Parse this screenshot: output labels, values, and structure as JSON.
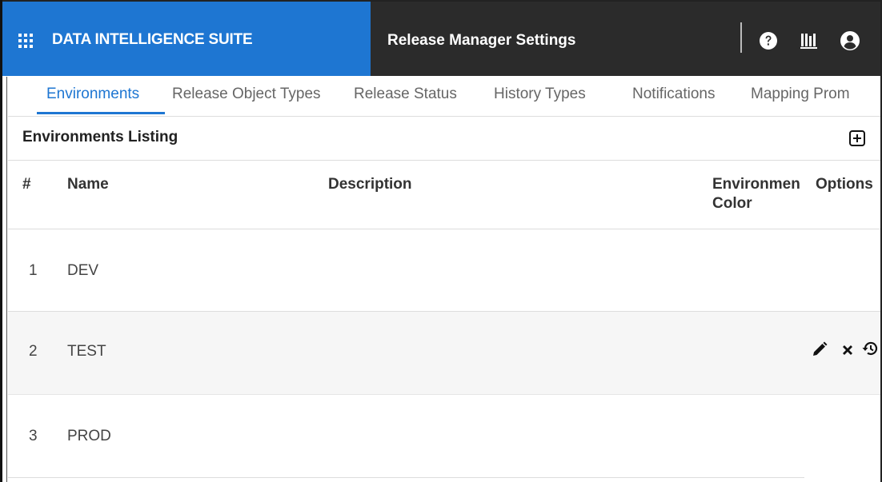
{
  "header": {
    "app_name": "DATA INTELLIGENCE SUITE",
    "page_title": "Release Manager Settings",
    "icons": [
      "apps-grid-icon",
      "help-icon",
      "library-icon",
      "user-account-icon"
    ]
  },
  "tabs": [
    {
      "label": "Environments",
      "active": true
    },
    {
      "label": "Release Object Types",
      "active": false
    },
    {
      "label": "Release Status",
      "active": false
    },
    {
      "label": "History Types",
      "active": false
    },
    {
      "label": "Notifications",
      "active": false
    },
    {
      "label": "Mapping Prom",
      "active": false
    }
  ],
  "listing": {
    "title": "Environments Listing",
    "columns": {
      "num": "#",
      "name": "Name",
      "description": "Description",
      "env_color_1": "Environmen",
      "env_color_2": "Color",
      "options": "Options"
    },
    "rows": [
      {
        "num": "1",
        "name": "DEV",
        "description": ""
      },
      {
        "num": "2",
        "name": "TEST",
        "description": ""
      },
      {
        "num": "3",
        "name": "PROD",
        "description": ""
      }
    ]
  },
  "colors": {
    "brand_blue": "#1e76d2",
    "topbar_dark": "#2b2b2b"
  }
}
